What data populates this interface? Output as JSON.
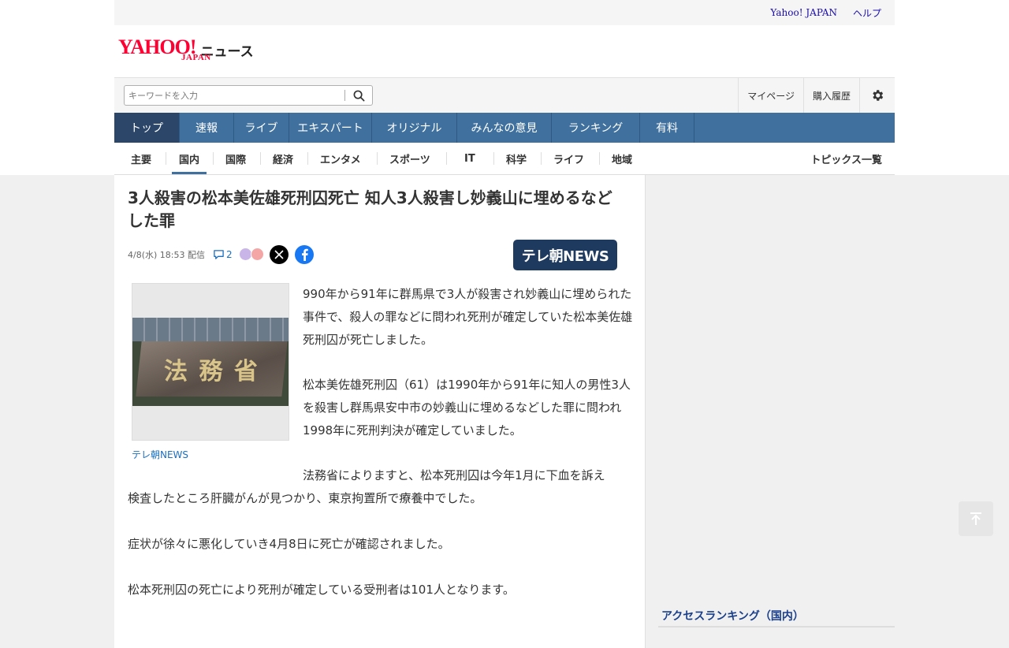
{
  "util": {
    "yahoo_japan": "Yahoo! JAPAN",
    "help": "ヘルプ"
  },
  "logo": {
    "yahoo": "YAHOO!",
    "japan": "JAPAN",
    "news": "ニュース"
  },
  "search": {
    "placeholder": "キーワードを入力"
  },
  "toplinks": {
    "mypage": "マイページ",
    "history": "購入履歴"
  },
  "mainnav": [
    "トップ",
    "速報",
    "ライブ",
    "エキスパート",
    "オリジナル",
    "みんなの意見",
    "ランキング",
    "有料"
  ],
  "subnav": {
    "items": [
      "主要",
      "国内",
      "国際",
      "経済",
      "エンタメ",
      "スポーツ",
      "IT",
      "科学",
      "ライフ",
      "地域"
    ],
    "active": "国内",
    "topics": "トピックス一覧"
  },
  "article": {
    "title": "3人殺害の松本美佐雄死刑囚死亡 知人3人殺害し妙義山に埋めるなどした罪",
    "date": "4/8(水) 18:53 配信",
    "comments": "2",
    "brand": "テレ朝NEWS",
    "photo_sign": "法 務 省",
    "caption": "テレ朝NEWS",
    "p1": "990年から91年に群馬県で3人が殺害され妙義山に埋められた事件で、殺人の罪などに問われ死刑が確定していた松本美佐雄死刑囚が死亡しました。",
    "p2": "松本美佐雄死刑囚（61）は1990年から91年に知人の男性3人を殺害し群馬県安中市の妙義山に埋めるなどした罪に問われ1998年に死刑判決が確定していました。",
    "p3a": "法務省によりますと、松本死刑囚は今年1月に下血を訴え",
    "p3b": "検査したところ肝臓がんが見つかり、東京拘置所で療養中でした。",
    "p4": "症状が徐々に悪化していき4月8日に死亡が確認されました。",
    "p5": "松本死刑囚の死亡により死刑が確定している受刑者は101人となります。"
  },
  "sidebar": {
    "ranking_title": "アクセスランキング（国内）"
  },
  "colors": {
    "nav": "#40719e",
    "nav_active": "#2b4668",
    "brand": "#1e3a5f",
    "link": "#1a6fbf",
    "logo": "#ff0033"
  }
}
